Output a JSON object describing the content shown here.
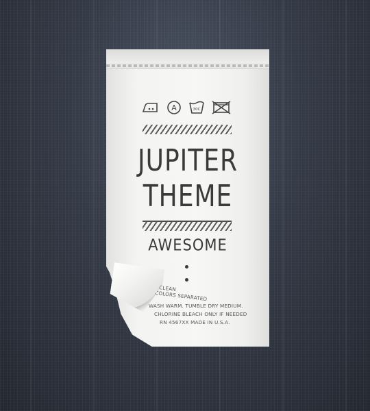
{
  "label": {
    "care_icons": [
      "iron-icon",
      "dry-clean-a-icon",
      "wash-30c-icon",
      "no-tumble-dry-icon"
    ],
    "wash_temp": "30C",
    "dry_clean_letter": "A",
    "title_line1": "JUPITER",
    "title_line2": "THEME",
    "subtitle": "AWESOME",
    "care_lines": [
      "DO NOT DRY CLEAN",
      "WASH DARK COLORS SEPARATED",
      "WASH WARM. TUMBLE DRY MEDIUM.",
      "CHLORINE BLEACH ONLY IF NEEDED",
      "RN 4567XX MADE IN U.S.A."
    ]
  }
}
